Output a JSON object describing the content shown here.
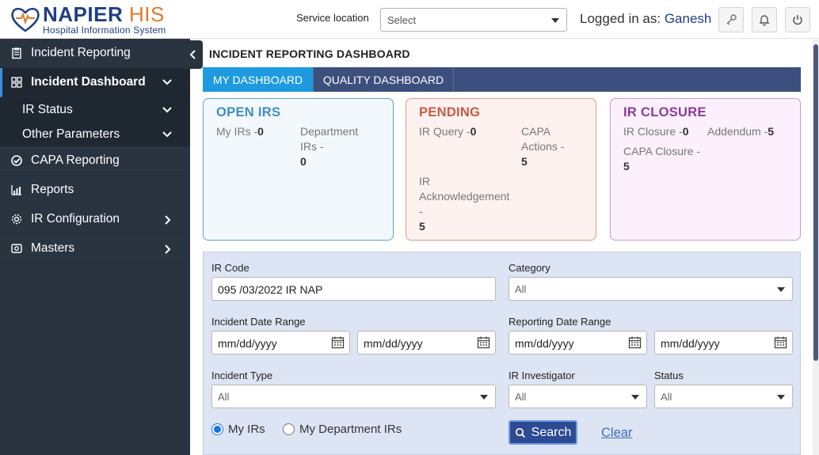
{
  "header": {
    "logo_title_main": "NAPIER",
    "logo_title_accent": "HIS",
    "logo_subtitle": "Hospital Information System",
    "service_location_label": "Service location",
    "service_location_value": "Select",
    "logged_in_prefix": "Logged in as:",
    "user_name": "Ganesh"
  },
  "sidebar": {
    "items": [
      {
        "label": "Incident Reporting",
        "icon": "clipboard-icon"
      },
      {
        "label": "Incident Dashboard",
        "icon": "dashboard-icon"
      },
      {
        "label": "IR Status"
      },
      {
        "label": "Other Parameters"
      },
      {
        "label": "CAPA Reporting",
        "icon": "check-circle-icon"
      },
      {
        "label": "Reports",
        "icon": "chart-icon"
      },
      {
        "label": "IR Configuration",
        "icon": "gear-icon"
      },
      {
        "label": "Masters",
        "icon": "database-icon"
      }
    ]
  },
  "main": {
    "title": "INCIDENT REPORTING DASHBOARD",
    "tabs": [
      {
        "label": "MY DASHBOARD"
      },
      {
        "label": "QUALITY DASHBOARD"
      }
    ]
  },
  "cards": {
    "open": {
      "title": "OPEN IRS",
      "my_irs_label": "My IRs -",
      "my_irs_value": "0",
      "dept_irs_label_1": "Department",
      "dept_irs_label_2": "IRs -",
      "dept_irs_value": "0"
    },
    "pending": {
      "title": "PENDING",
      "ir_query_label": "IR Query -",
      "ir_query_value": "0",
      "capa_label_1": "CAPA",
      "capa_label_2": "Actions -",
      "capa_value": "5",
      "ack_label_1": "IR",
      "ack_label_2": "Acknowledgement",
      "ack_label_3": "-",
      "ack_value": "5"
    },
    "closure": {
      "title": "IR CLOSURE",
      "ir_closure_label": "IR Closure -",
      "ir_closure_value": "0",
      "addendum_label": "Addendum -",
      "addendum_value": "5",
      "capa_closure_label": "CAPA Closure -",
      "capa_closure_value": "5"
    }
  },
  "filters": {
    "ir_code_label": "IR Code",
    "ir_code_value": "095 /03/2022 IR NAP",
    "category_label": "Category",
    "category_value": "All",
    "incident_date_label": "Incident Date Range",
    "reporting_date_label": "Reporting Date Range",
    "date_placeholder": "mm/dd/yyyy",
    "incident_type_label": "Incident Type",
    "incident_type_value": "All",
    "investigator_label": "IR Investigator",
    "investigator_value": "All",
    "status_label": "Status",
    "status_value": "All",
    "radio_my_irs": "My IRs",
    "radio_dept_irs": "My Department IRs",
    "search_label": "Search",
    "clear_label": "Clear"
  }
}
